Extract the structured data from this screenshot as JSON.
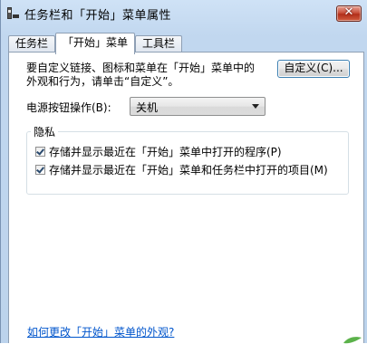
{
  "window": {
    "title": "任务栏和「开始」菜单属性",
    "close_glyph": "✕",
    "app_icon": "taskbar-properties-icon"
  },
  "tabs": [
    {
      "label": "任务栏",
      "active": false
    },
    {
      "label": "「开始」菜单",
      "active": true
    },
    {
      "label": "工具栏",
      "active": false
    }
  ],
  "start_menu": {
    "description_line1": "要自定义链接、图标和菜单在「开始」菜单中的",
    "description_line2": "外观和行为，请单击“自定义”。",
    "customize_button": "自定义(C)...",
    "power_label": "电源按钮操作(B):",
    "power_value": "关机",
    "privacy": {
      "title": "隐私",
      "option1": "存储并显示最近在「开始」菜单中打开的程序(P)",
      "option1_checked": true,
      "option2": "存储并显示最近在「开始」菜单和任务栏中打开的项目(M)",
      "option2_checked": true
    },
    "help_link": "如何更改「开始」菜单的外观?"
  },
  "colors": {
    "title_bg": "#c6dbf2",
    "close_button": "#c44a33",
    "link": "#0055cc",
    "button_border": "#3c7fb1"
  }
}
